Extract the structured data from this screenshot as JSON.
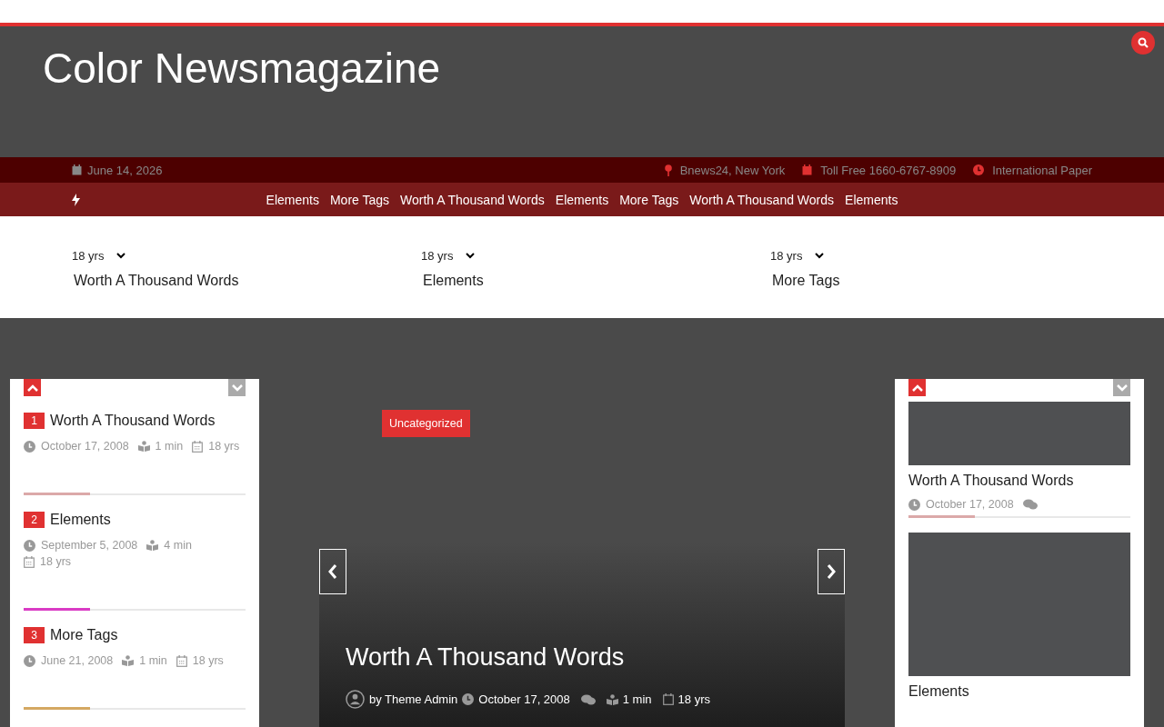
{
  "site": {
    "title": "Color Newsmagazine"
  },
  "topbar": {
    "date": "June 14, 2026",
    "location": "Bnews24, New York",
    "phone": "Toll Free 1660-6767-8909",
    "paper": "International Paper"
  },
  "nav": {
    "items": [
      "Elements",
      "More Tags",
      "Worth A Thousand Words",
      "Elements",
      "More Tags",
      "Worth A Thousand Words",
      "Elements"
    ]
  },
  "trending": [
    {
      "age": "18 yrs",
      "title": "Worth A Thousand Words"
    },
    {
      "age": "18 yrs",
      "title": "Elements"
    },
    {
      "age": "18 yrs",
      "title": "More Tags"
    }
  ],
  "left_list": {
    "items": [
      {
        "rank": "1",
        "title": "Worth A Thousand Words",
        "date": "October 17, 2008",
        "read": "1 min",
        "age": "18 yrs",
        "color": "#dba9a9"
      },
      {
        "rank": "2",
        "title": "Elements",
        "date": "September 5, 2008",
        "read": "4 min",
        "age": "18 yrs",
        "color": "#d93bc4"
      },
      {
        "rank": "3",
        "title": "More Tags",
        "date": "June 21, 2008",
        "read": "1 min",
        "age": "18 yrs",
        "color": "#d4a862"
      }
    ]
  },
  "slider": {
    "category": "Uncategorized",
    "title": "Worth A Thousand Words",
    "author": "by Theme Admin",
    "date": "October 17, 2008",
    "read": "1 min",
    "age": "18 yrs"
  },
  "right_list": {
    "items": [
      {
        "title": "Worth A Thousand Words",
        "date": "October 17, 2008",
        "color": "#dba9a9"
      },
      {
        "title": "Elements"
      }
    ]
  }
}
